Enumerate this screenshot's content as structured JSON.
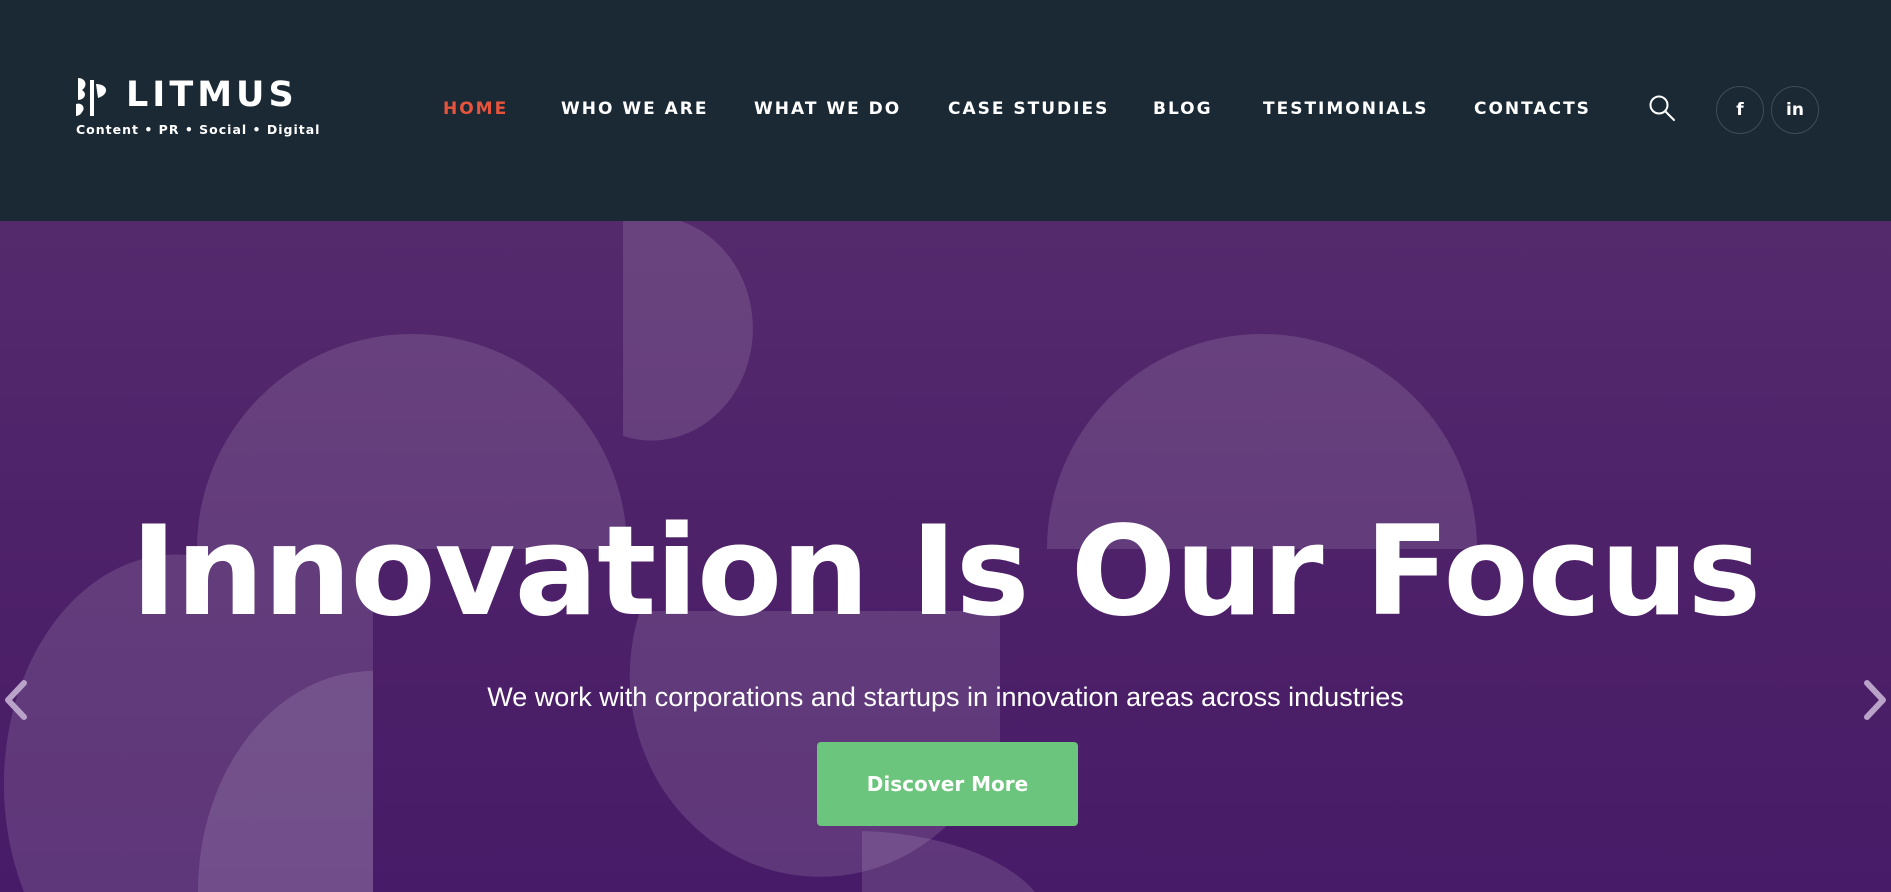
{
  "brand": {
    "name": "LITMUS",
    "tagline": "Content • PR • Social • Digital"
  },
  "nav": {
    "items": [
      {
        "label": "HOME",
        "active": true
      },
      {
        "label": "WHO WE ARE",
        "active": false
      },
      {
        "label": "WHAT WE DO",
        "active": false
      },
      {
        "label": "CASE STUDIES",
        "active": false
      },
      {
        "label": "BLOG",
        "active": false
      },
      {
        "label": "TESTIMONIALS",
        "active": false
      },
      {
        "label": "CONTACTS",
        "active": false
      }
    ],
    "search_icon": "search-icon",
    "social": [
      {
        "icon": "facebook-icon",
        "glyph": "f"
      },
      {
        "icon": "linkedin-icon",
        "glyph": "in"
      }
    ]
  },
  "hero": {
    "title": "Innovation Is Our Focus",
    "subtitle": "We work with corporations and startups in innovation areas across industries",
    "cta_label": "Discover More",
    "prev_icon": "chevron-left-icon",
    "next_icon": "chevron-right-icon"
  },
  "colors": {
    "header_bg": "#1b2934",
    "nav_active": "#e8543b",
    "hero_bg": "#4e2269",
    "cta_bg": "#6cc57c"
  }
}
